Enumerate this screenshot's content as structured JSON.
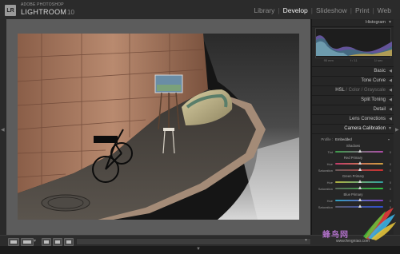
{
  "app": {
    "logo": "LR",
    "brand_small": "ADOBE PHOTOSHOP",
    "brand_name": "LIGHTROOM",
    "version": "10"
  },
  "modules": [
    {
      "label": "Library",
      "active": false
    },
    {
      "label": "Develop",
      "active": true
    },
    {
      "label": "Slideshow",
      "active": false
    },
    {
      "label": "Print",
      "active": false
    },
    {
      "label": "Web",
      "active": false
    }
  ],
  "histogram": {
    "title": "Histogram",
    "stats": [
      "95 mm",
      "f / 11",
      "1/ sec"
    ]
  },
  "sections": [
    {
      "label": "Basic"
    },
    {
      "label": "Tone Curve"
    },
    {
      "label": "HSL",
      "suffix": " / Color / Grayscale"
    },
    {
      "label": "Split Toning"
    },
    {
      "label": "Detail"
    },
    {
      "label": "Lens Corrections"
    },
    {
      "label": "Camera Calibration"
    }
  ],
  "calibration": {
    "profile_label": "Profile :",
    "profile_value": "Embedded",
    "groups": [
      {
        "title": "Shadows",
        "rows": [
          {
            "label": "Tint",
            "gradient": "green-magenta",
            "pos": 0.5
          }
        ]
      },
      {
        "title": "Red Primary",
        "rows": [
          {
            "label": "Hue",
            "gradient": "red-hue",
            "pos": 0.5
          },
          {
            "label": "Saturation",
            "gradient": "red-sat",
            "pos": 0.5
          }
        ]
      },
      {
        "title": "Green Primary",
        "rows": [
          {
            "label": "Hue",
            "gradient": "green-hue",
            "pos": 0.5
          },
          {
            "label": "Saturation",
            "gradient": "green-sat",
            "pos": 0.5
          }
        ]
      },
      {
        "title": "Blue Primary",
        "rows": [
          {
            "label": "Hue",
            "gradient": "blue-hue",
            "pos": 0.5
          },
          {
            "label": "Saturation",
            "gradient": "blue-sat",
            "pos": 0.5
          }
        ]
      }
    ]
  },
  "watermark": {
    "text": "蜂鸟网",
    "url": "www.fengniao.com"
  },
  "icons": {
    "panel_collapse": "triangle-left-icon",
    "filmstrip_toggle": "triangle-down-icon"
  },
  "colors": {
    "accent": "#f0f0f0",
    "panel_bg": "#262626"
  }
}
